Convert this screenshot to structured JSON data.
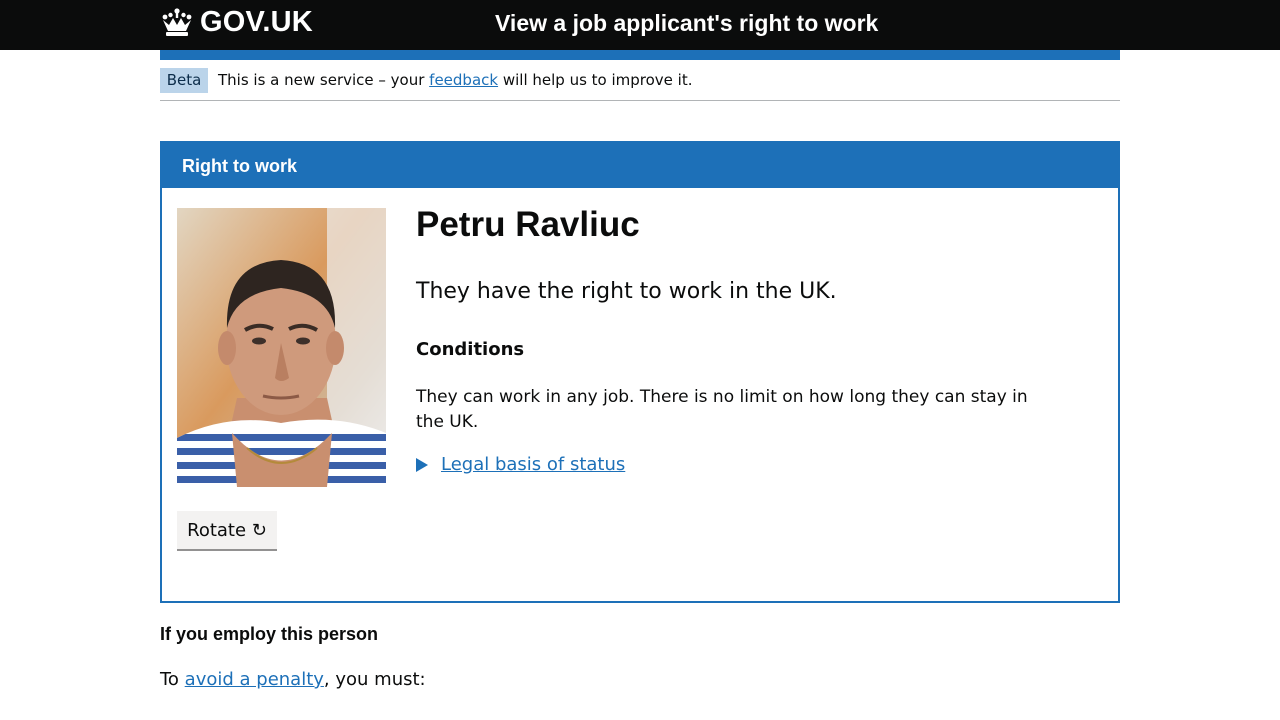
{
  "header": {
    "logo_text": "GOV.UK",
    "service_name": "View a job applicant's right to work",
    "crown_icon": "crown-icon"
  },
  "phase_banner": {
    "tag": "Beta",
    "text_before": "This is a new service – your ",
    "link": "feedback",
    "text_after": " will help us to improve it."
  },
  "panel": {
    "title": "Right to work",
    "name": "Petru Ravliuc",
    "status": "They have the right to work in the UK.",
    "conditions_heading": "Conditions",
    "conditions_text": "They can work in any job. There is no limit on how long they can stay in the UK.",
    "details_link": "Legal basis of status",
    "rotate_button": "Rotate ↻"
  },
  "employ": {
    "heading": "If you employ this person",
    "text_before": "To ",
    "link": "avoid a penalty",
    "text_after": ", you must:"
  },
  "colors": {
    "brand_blue": "#1d70b8",
    "header_black": "#0b0c0c",
    "beta_tag": "#bbd4ea"
  }
}
